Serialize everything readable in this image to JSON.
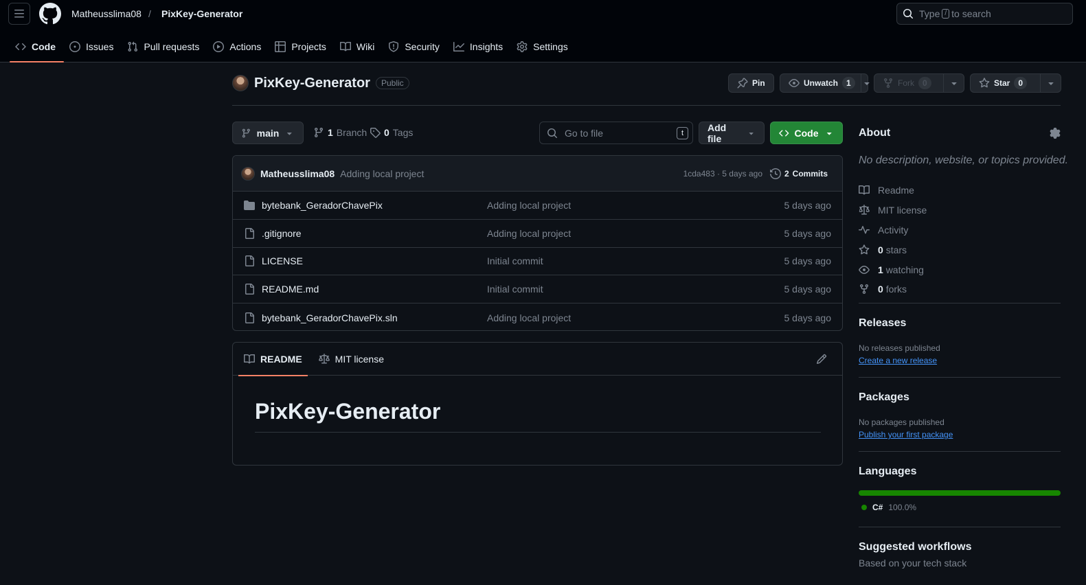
{
  "header": {
    "owner": "Matheusslima08",
    "separator": "/",
    "repo": "PixKey-Generator",
    "search_before": "Type",
    "search_key": "/",
    "search_after": "to search"
  },
  "nav": [
    {
      "label": "Code",
      "icon": "code-icon"
    },
    {
      "label": "Issues",
      "icon": "issue-icon"
    },
    {
      "label": "Pull requests",
      "icon": "pull-request-icon"
    },
    {
      "label": "Actions",
      "icon": "play-icon"
    },
    {
      "label": "Projects",
      "icon": "table-icon"
    },
    {
      "label": "Wiki",
      "icon": "book-icon"
    },
    {
      "label": "Security",
      "icon": "shield-icon"
    },
    {
      "label": "Insights",
      "icon": "graph-icon"
    },
    {
      "label": "Settings",
      "icon": "gear-icon"
    }
  ],
  "repo": {
    "name": "PixKey-Generator",
    "visibility": "Public",
    "pin_label": "Pin",
    "unwatch_label": "Unwatch",
    "watch_count": "1",
    "fork_label": "Fork",
    "fork_count": "0",
    "star_label": "Star",
    "star_count": "0"
  },
  "toolbar": {
    "branch": "main",
    "branch_count": "1",
    "branch_label": "Branch",
    "tag_count": "0",
    "tag_label": "Tags",
    "goto_placeholder": "Go to file",
    "goto_key": "t",
    "add_file_label": "Add file",
    "code_label": "Code"
  },
  "commit": {
    "author": "Matheusslima08",
    "message": "Adding local project",
    "meta": "1cda483 · 5 days ago",
    "commits_count": "2",
    "commits_label": "Commits"
  },
  "files": [
    {
      "name": "bytebank_GeradorChavePix",
      "type": "folder",
      "message": "Adding local project",
      "age": "5 days ago"
    },
    {
      "name": ".gitignore",
      "type": "file",
      "message": "Adding local project",
      "age": "5 days ago"
    },
    {
      "name": "LICENSE",
      "type": "file",
      "message": "Initial commit",
      "age": "5 days ago"
    },
    {
      "name": "README.md",
      "type": "file",
      "message": "Initial commit",
      "age": "5 days ago"
    },
    {
      "name": "bytebank_GeradorChavePix.sln",
      "type": "file",
      "message": "Adding local project",
      "age": "5 days ago"
    }
  ],
  "readme": {
    "tab_readme": "README",
    "tab_license": "MIT license",
    "heading": "PixKey-Generator"
  },
  "sidebar": {
    "about_title": "About",
    "about_desc": "No description, website, or topics provided.",
    "items": [
      {
        "bold": "",
        "text": "Readme",
        "icon": "book-icon"
      },
      {
        "bold": "",
        "text": "MIT license",
        "icon": "law-icon"
      },
      {
        "bold": "",
        "text": "Activity",
        "icon": "pulse-icon"
      },
      {
        "bold": "0",
        "text": "stars",
        "icon": "star-icon"
      },
      {
        "bold": "1",
        "text": "watching",
        "icon": "eye-icon"
      },
      {
        "bold": "0",
        "text": "forks",
        "icon": "fork-icon"
      }
    ],
    "releases_title": "Releases",
    "releases_none": "No releases published",
    "releases_link": "Create a new release",
    "packages_title": "Packages",
    "packages_none": "No packages published",
    "packages_link": "Publish your first package",
    "languages_title": "Languages",
    "language_name": "C#",
    "language_pct": "100.0%",
    "language_pct_value": 100,
    "language_color": "#178600",
    "workflows_title": "Suggested workflows",
    "workflows_sub": "Based on your tech stack"
  },
  "colors": {
    "accent_tab": "#f78166",
    "code_button": "#238636",
    "link": "#4493f8",
    "background": "#0d1117"
  }
}
